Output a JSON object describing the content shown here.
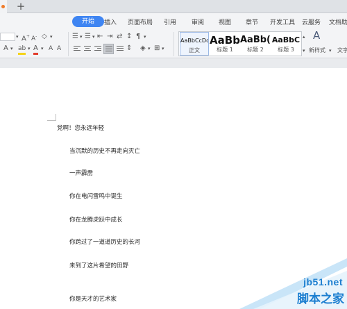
{
  "tabbar": {
    "new_tab_label": "+"
  },
  "menubar": {
    "items": [
      "开始",
      "插入",
      "页面布局",
      "引用",
      "审阅",
      "视图",
      "章节",
      "开发工具",
      "云服务",
      "文档助手"
    ],
    "active_index": 0,
    "accent": "#3f85f2"
  },
  "ribbon": {
    "font_size_value": "",
    "styles": [
      {
        "sample": "AaBbCcDd",
        "name": "正文"
      },
      {
        "sample": "AaBb",
        "name": "标题 1"
      },
      {
        "sample": "AaBb(",
        "name": "标题 2"
      },
      {
        "sample": "AaBbC",
        "name": "标题 3"
      }
    ],
    "new_style_label": "新样式",
    "text_tool_label": "文字"
  },
  "document": {
    "lines": [
      "党啊！您永远年轻",
      "当沉默的历史不再走向灭亡",
      "一声霹雳",
      "你在电闪雷鸣中诞生",
      "你在龙腾虎跃中成长",
      "你跨过了一道道历史的长河",
      "来到了这片希望的田野",
      "你是天才的艺术家"
    ]
  },
  "watermark": {
    "site": "jb51.net",
    "name": "脚本之家",
    "color": "#1d7fd0"
  },
  "icons": [
    "new-tab-icon",
    "font-grow-icon",
    "font-shrink-icon",
    "clear-format-icon",
    "font-color-icon",
    "highlight-icon",
    "bullets-icon",
    "numbering-icon",
    "indent-icon",
    "align-left-icon",
    "align-center-icon",
    "align-right-icon",
    "justify-icon",
    "shading-icon",
    "borders-icon",
    "new-style-icon"
  ]
}
